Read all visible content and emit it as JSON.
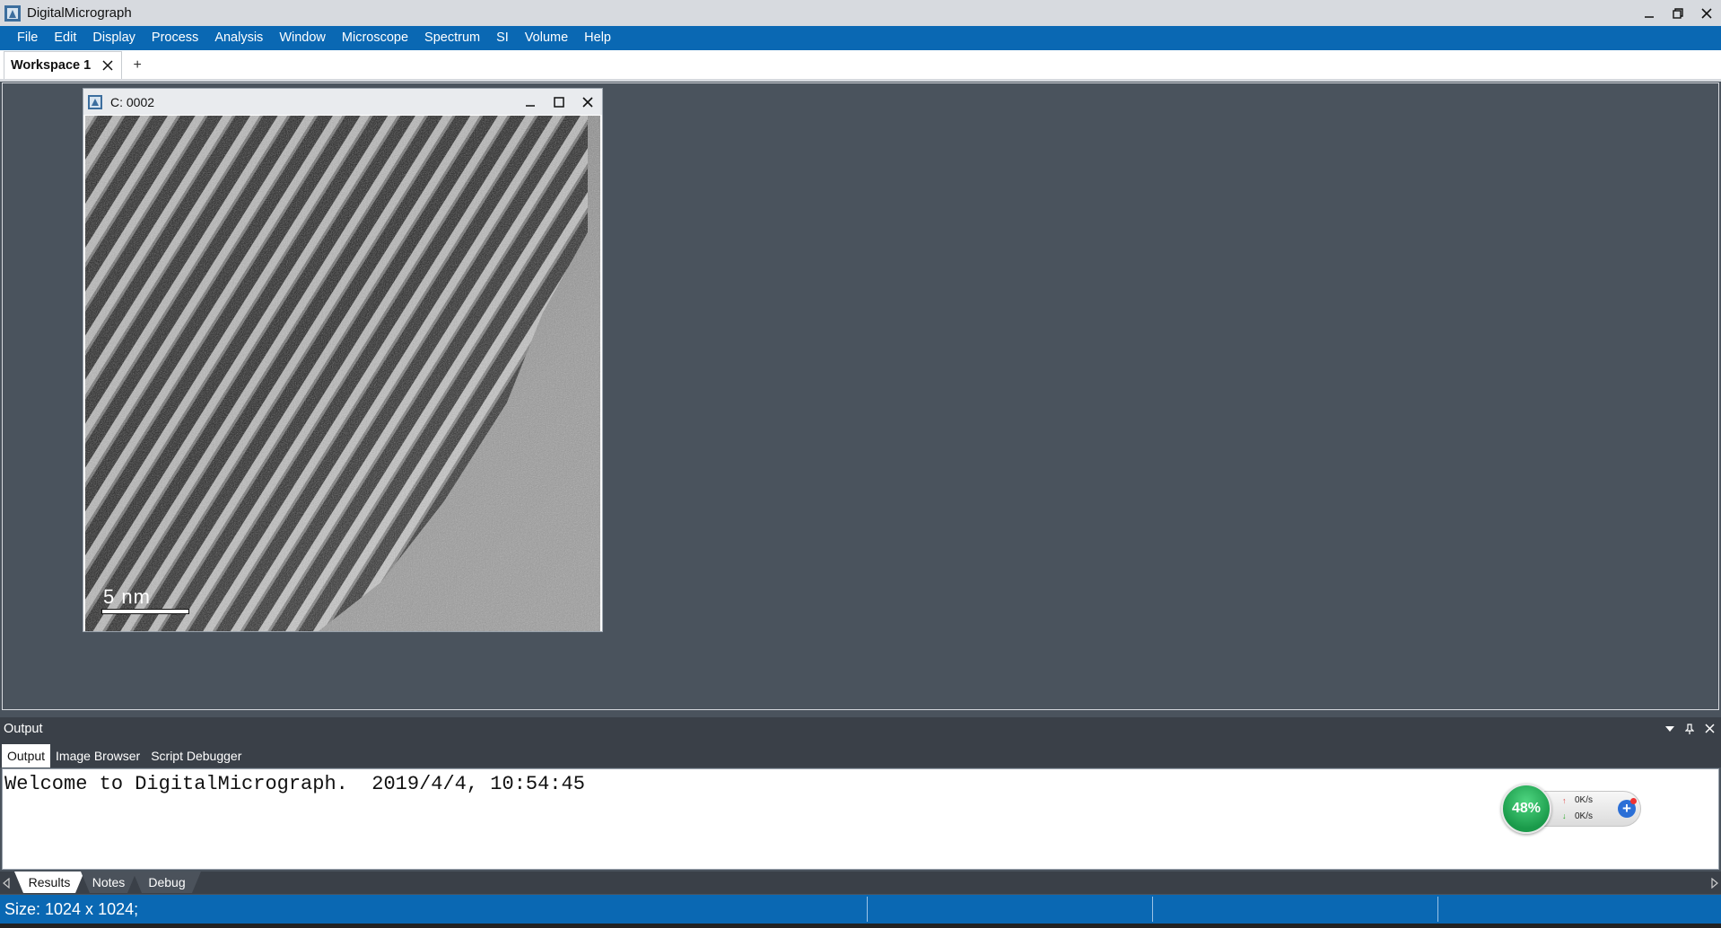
{
  "app": {
    "title": "DigitalMicrograph"
  },
  "menu": [
    "File",
    "Edit",
    "Display",
    "Process",
    "Analysis",
    "Window",
    "Microscope",
    "Spectrum",
    "SI",
    "Volume",
    "Help"
  ],
  "workspace_tabs": [
    {
      "label": "Workspace 1",
      "active": true
    }
  ],
  "add_tab_label": "+",
  "image_window": {
    "title": "C: 0002",
    "scalebar_label": "5 nm",
    "image_description_icon": "hrtem-lattice-image"
  },
  "output_panel": {
    "title": "Output",
    "tabs": [
      {
        "label": "Output",
        "active": true
      },
      {
        "label": "Image Browser",
        "active": false
      },
      {
        "label": "Script Debugger",
        "active": false
      }
    ],
    "console_text": "Welcome to DigitalMicrograph.  2019/4/4, 10:54:45"
  },
  "net_widget": {
    "percent": "48%",
    "upload": "0K/s",
    "download": "0K/s"
  },
  "bottom_tabs": [
    {
      "label": "Results",
      "active": true
    },
    {
      "label": "Notes",
      "active": false
    },
    {
      "label": "Debug",
      "active": false
    }
  ],
  "status": {
    "text": "Size: 1024 x 1024;"
  },
  "colors": {
    "menubar": "#0a68b3",
    "workspace": "#4a535d",
    "panel": "#3a4048"
  }
}
